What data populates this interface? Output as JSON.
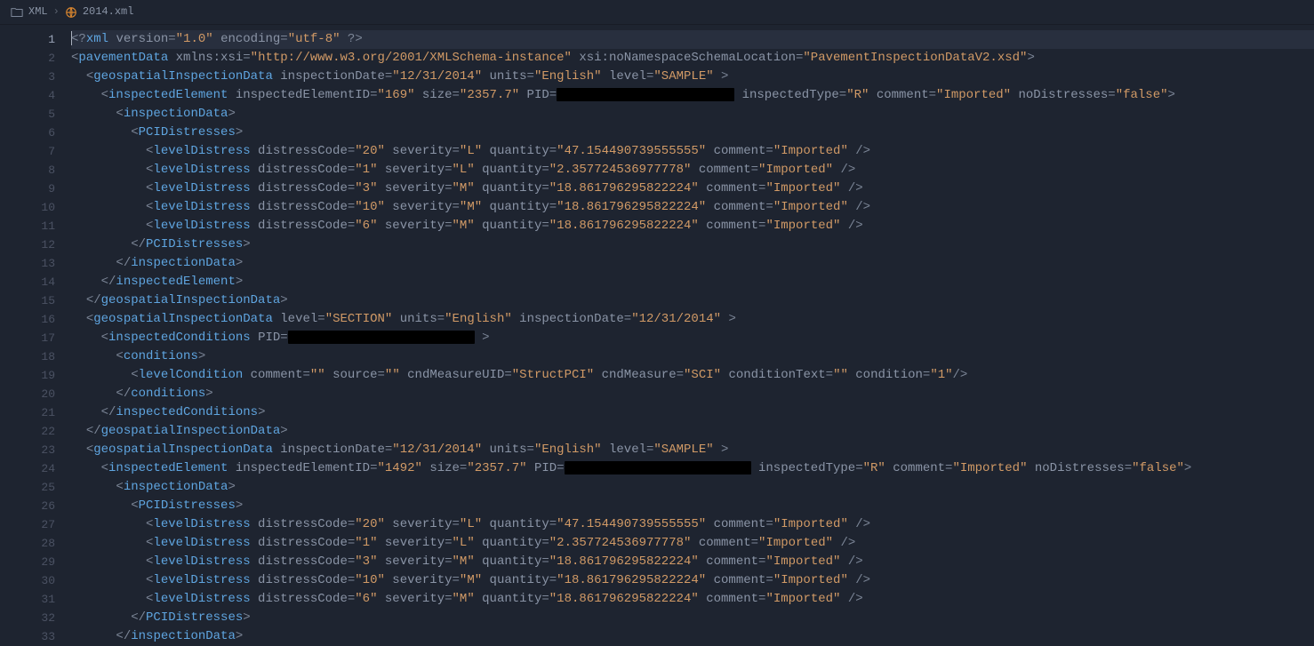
{
  "breadcrumb": {
    "folder": "XML",
    "file": "2014.xml"
  },
  "editor": {
    "first_line": 1,
    "last_line": 33,
    "highlighted_line": 1
  },
  "xml": {
    "declaration": {
      "version": "1.0",
      "encoding": "utf-8"
    },
    "root": {
      "tag": "pavementData",
      "xmlns_xsi": "http://www.w3.org/2001/XMLSchema-instance",
      "noNamespaceSchemaLocation": "PavementInspectionDataV2.xsd"
    },
    "blocks": [
      {
        "type": "geospatialInspectionData",
        "inspectionDate": "12/31/2014",
        "units": "English",
        "level": "SAMPLE",
        "inspectedElement": {
          "inspectedElementID": "169",
          "size": "2357.7",
          "PID": "[REDACTED]",
          "inspectedType": "R",
          "comment": "Imported",
          "noDistresses": "false",
          "PCIDistresses": [
            {
              "distressCode": "20",
              "severity": "L",
              "quantity": "47.154490739555555",
              "comment": "Imported"
            },
            {
              "distressCode": "1",
              "severity": "L",
              "quantity": "2.357724536977778",
              "comment": "Imported"
            },
            {
              "distressCode": "3",
              "severity": "M",
              "quantity": "18.861796295822224",
              "comment": "Imported"
            },
            {
              "distressCode": "10",
              "severity": "M",
              "quantity": "18.861796295822224",
              "comment": "Imported"
            },
            {
              "distressCode": "6",
              "severity": "M",
              "quantity": "18.861796295822224",
              "comment": "Imported"
            }
          ]
        }
      },
      {
        "type": "geospatialInspectionData",
        "level": "SECTION",
        "units": "English",
        "inspectionDate": "12/31/2014",
        "inspectedConditions": {
          "PID": "[REDACTED]",
          "conditions": [
            {
              "comment": "",
              "source": "",
              "cndMeasureUID": "StructPCI",
              "cndMeasure": "SCI",
              "conditionText": "",
              "condition": "1"
            }
          ]
        }
      },
      {
        "type": "geospatialInspectionData",
        "inspectionDate": "12/31/2014",
        "units": "English",
        "level": "SAMPLE",
        "inspectedElement": {
          "inspectedElementID": "1492",
          "size": "2357.7",
          "PID": "[REDACTED]",
          "inspectedType": "R",
          "comment": "Imported",
          "noDistresses": "false",
          "PCIDistresses": [
            {
              "distressCode": "20",
              "severity": "L",
              "quantity": "47.154490739555555",
              "comment": "Imported"
            },
            {
              "distressCode": "1",
              "severity": "L",
              "quantity": "2.357724536977778",
              "comment": "Imported"
            },
            {
              "distressCode": "3",
              "severity": "M",
              "quantity": "18.861796295822224",
              "comment": "Imported"
            },
            {
              "distressCode": "10",
              "severity": "M",
              "quantity": "18.861796295822224",
              "comment": "Imported"
            },
            {
              "distressCode": "6",
              "severity": "M",
              "quantity": "18.861796295822224",
              "comment": "Imported"
            }
          ]
        }
      }
    ]
  }
}
